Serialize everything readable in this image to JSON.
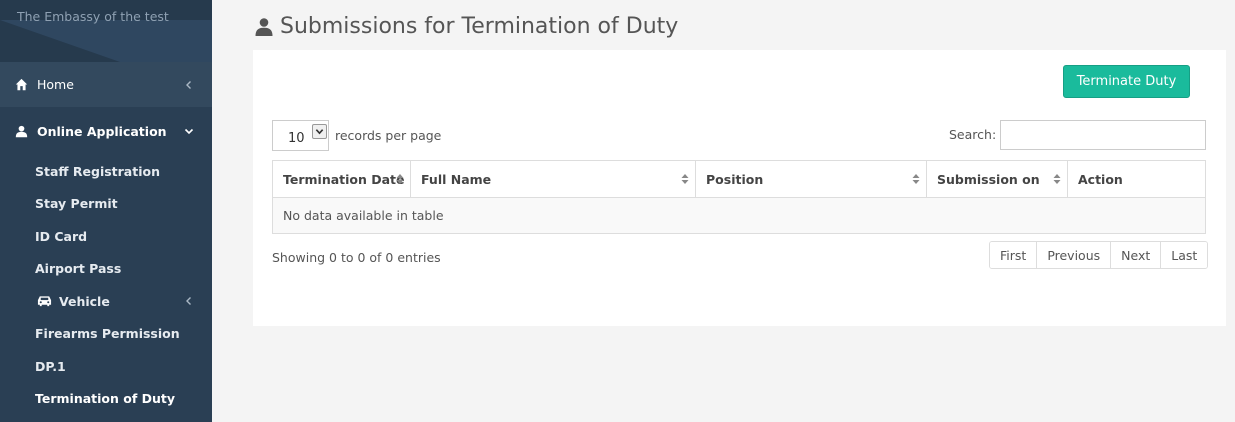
{
  "brand": {
    "title": "The Embassy of the test"
  },
  "nav": {
    "home_label": "Home",
    "online_label": "Online Application",
    "sub_items": [
      {
        "label": "Staff Registration"
      },
      {
        "label": "Stay Permit"
      },
      {
        "label": "ID Card"
      },
      {
        "label": "Airport Pass"
      },
      {
        "label": "Vehicle"
      },
      {
        "label": "Firearms Permission"
      },
      {
        "label": "DP.1"
      },
      {
        "label": "Termination of Duty"
      }
    ]
  },
  "page": {
    "title": "Submissions for Termination of Duty"
  },
  "toolbar": {
    "terminate_label": "Terminate Duty"
  },
  "table_controls": {
    "length_value": "10",
    "length_label": "records per page",
    "search_label": "Search:",
    "search_value": ""
  },
  "table": {
    "columns": [
      "Termination Date",
      "Full Name",
      "Position",
      "Submission on",
      "Action"
    ],
    "empty_message": "No data available in table",
    "info": "Showing 0 to 0 of 0 entries"
  },
  "pager": {
    "first": "First",
    "previous": "Previous",
    "next": "Next",
    "last": "Last"
  },
  "colors": {
    "sidebar": "#2a3f54",
    "accent": "#1abb9c"
  },
  "icons": [
    "home-icon",
    "user-icon",
    "car-icon",
    "chevron-left-icon",
    "chevron-down-icon",
    "sort-icon"
  ]
}
